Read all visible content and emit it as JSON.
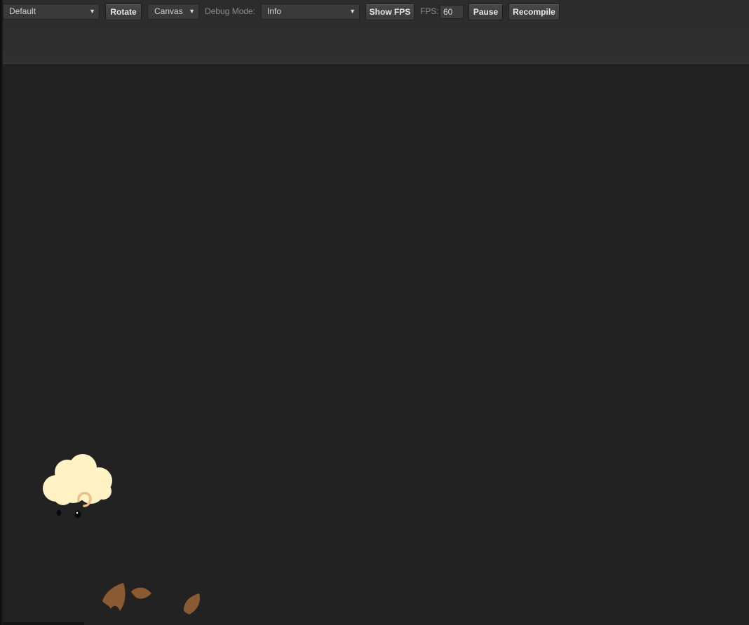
{
  "toolbar": {
    "preset_select": {
      "value": "Default"
    },
    "rotate_label": "Rotate",
    "renderer_select": {
      "value": "Canvas"
    },
    "debug_mode_label": "Debug Mode:",
    "debug_mode_select": {
      "value": "Info"
    },
    "show_fps_label": "Show FPS",
    "fps_label": "FPS:",
    "fps_value": "60",
    "pause_label": "Pause",
    "recompile_label": "Recompile"
  },
  "icons": {
    "dropdown_arrow": "▼"
  },
  "canvas": {
    "sprites": [
      "cloud-sheep-sprite",
      "leaf-sprite",
      "leaf-sprite",
      "leaf-sprite"
    ]
  },
  "colors": {
    "background": "#222222",
    "toolbar": "#2e2e2e",
    "cloud": "#fff3c4",
    "cloud_curl": "#e8c088",
    "leaf": "#8a5a32"
  }
}
